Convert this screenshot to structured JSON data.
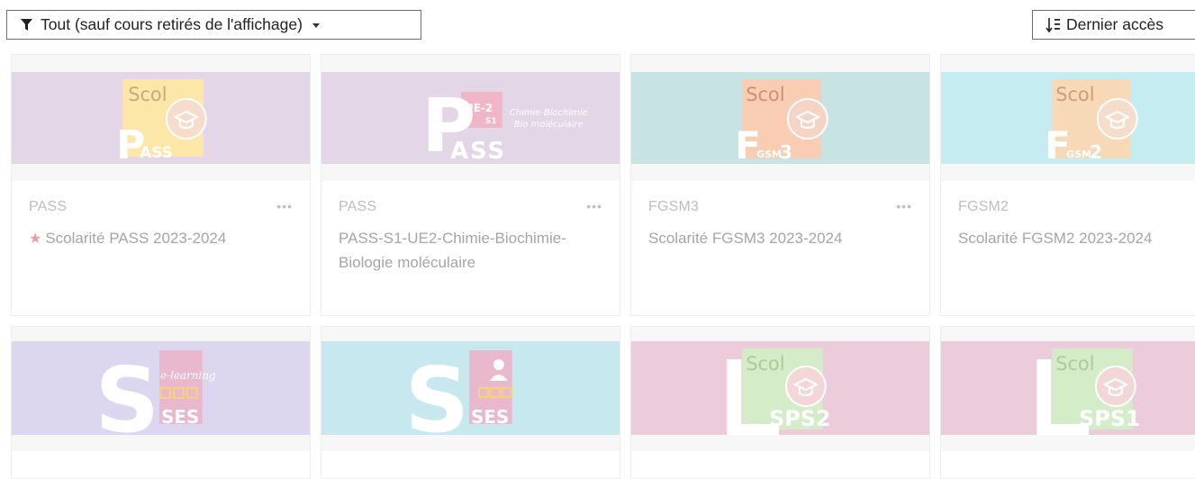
{
  "toolbar": {
    "filter_label": "Tout (sauf cours retirés de l'affichage)",
    "sort_label": "Dernier accès"
  },
  "cards": [
    {
      "category": "PASS",
      "name": "Scolarité PASS 2023-2024",
      "starred": true,
      "banner_color": "#e3d6e6"
    },
    {
      "category": "PASS",
      "name": "PASS-S1-UE2-Chimie-Biochimie-Biologie moléculaire",
      "starred": false,
      "banner_color": "#e3d6e6"
    },
    {
      "category": "FGSM3",
      "name": "Scolarité FGSM3 2023-2024",
      "starred": false,
      "banner_color": "#c7e3e3"
    },
    {
      "category": "FGSM2",
      "name": "Scolarité FGSM2 2023-2024",
      "starred": false,
      "banner_color": "#c4ecf1"
    },
    {
      "banner_color": "#ddd6ef"
    },
    {
      "banner_color": "#c6e8ee"
    },
    {
      "banner_color": "#ecccdb"
    },
    {
      "banner_color": "#ecccdb"
    }
  ],
  "banner_text": {
    "scol": "Scol",
    "pass_p": "P",
    "pass_rest": "ASS",
    "ue2": "UE-2",
    "s1": "S1",
    "chimie": "Chimie-Biochimie",
    "bio": "Bio moléculaire",
    "f": "F",
    "gsm": "GSM",
    "three": "3",
    "two": "2",
    "s": "S",
    "elearning": "e-learning",
    "ses": "SES",
    "l": "L",
    "sps2": "SPS2",
    "sps1": "SPS1"
  },
  "colors": {
    "yellow_square": "#fde7a8",
    "salmon_square": "#f8cdb4",
    "orange_square": "#f7d9b8",
    "pink_square": "#f0b6c6",
    "green_square": "#d4ecc7"
  },
  "icons": {
    "filter": "funnel-icon",
    "sort": "sort-numeric-down-icon",
    "course_actions": "ellipsis-icon",
    "favourite": "star-icon",
    "graduation": "graduation-cap-icon"
  }
}
